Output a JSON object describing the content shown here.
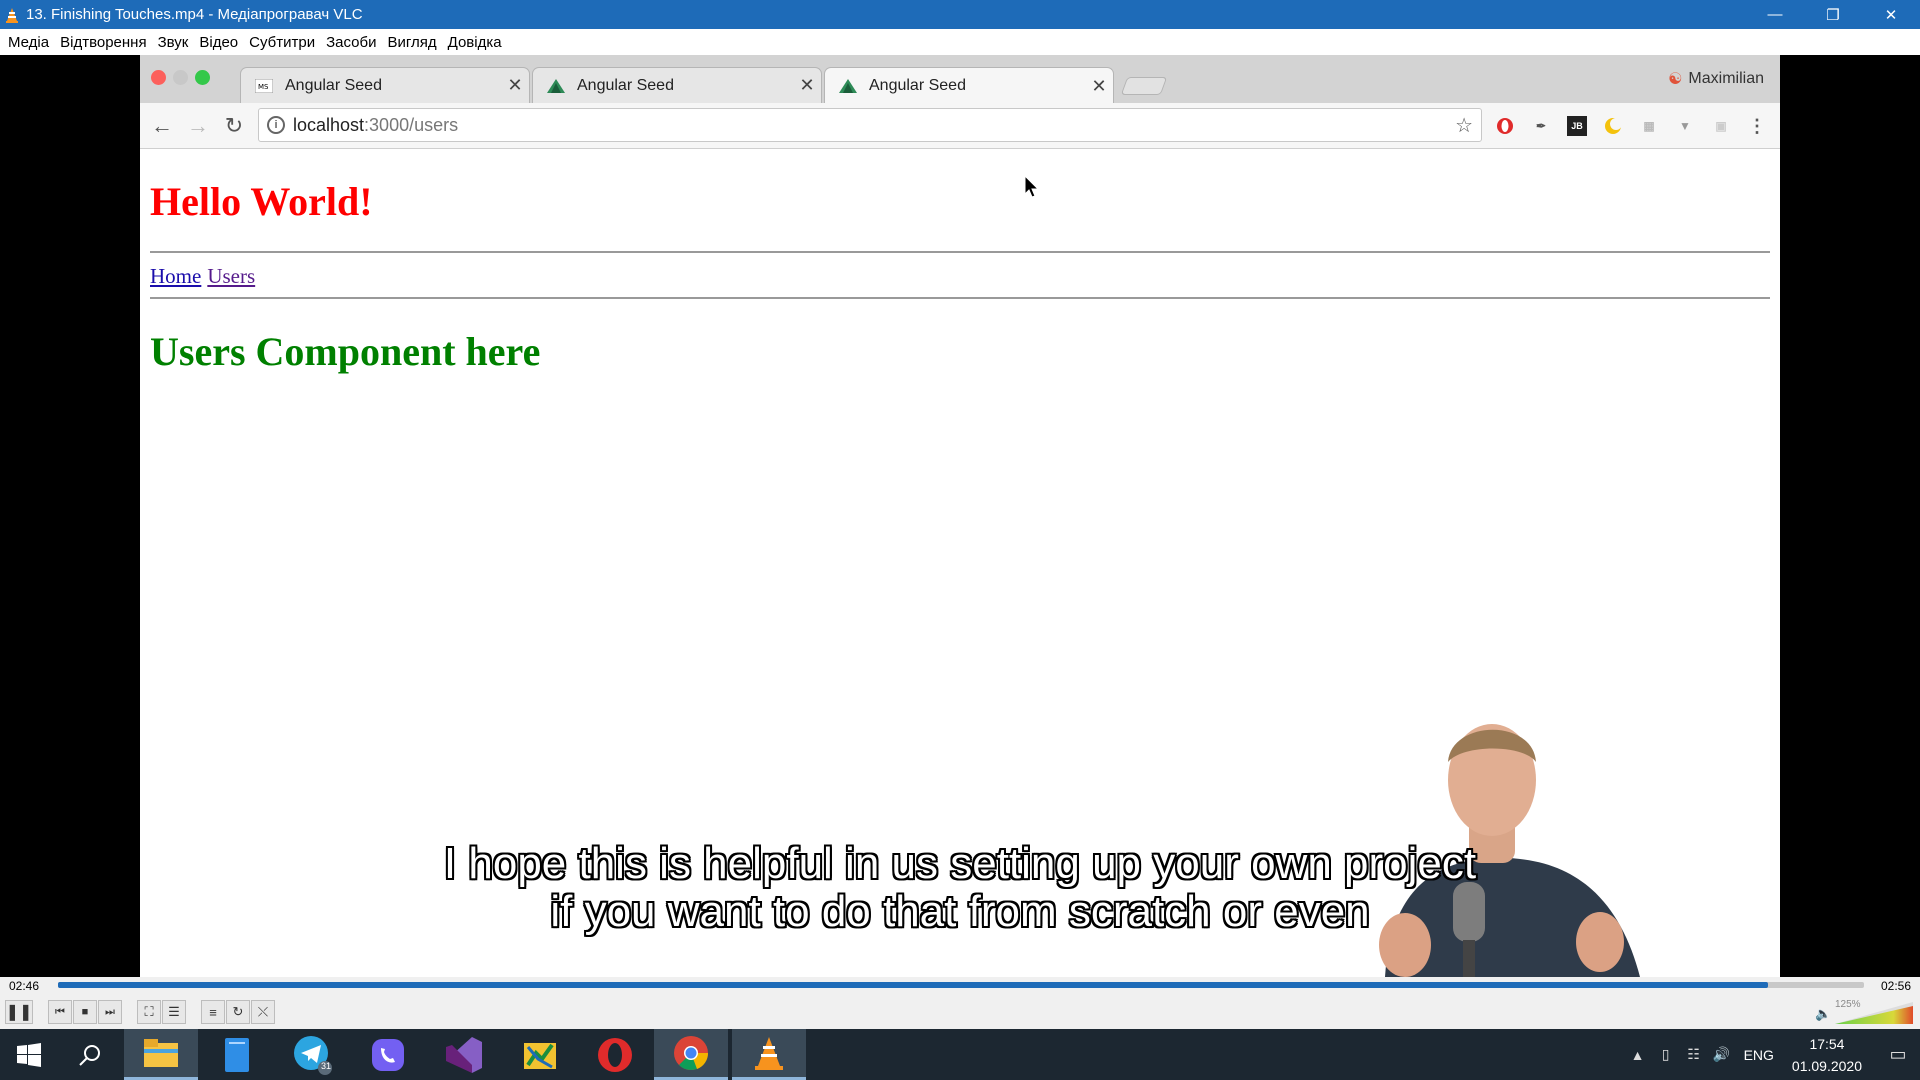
{
  "vlc": {
    "window_title": "13. Finishing Touches.mp4 - Медіапрогравач VLC",
    "menu": [
      "Медіа",
      "Відтворення",
      "Звук",
      "Відео",
      "Субтитри",
      "Засоби",
      "Вигляд",
      "Довідка"
    ],
    "time_elapsed": "02:46",
    "time_total": "02:56",
    "progress": 0.947,
    "volume_label": "125%",
    "subtitle_line1": "I hope this is helpful in us setting up your own project",
    "subtitle_line2": "if you want to do that from scratch or even"
  },
  "browser": {
    "tabs": [
      {
        "title": "Angular Seed",
        "active": false
      },
      {
        "title": "Angular Seed",
        "active": false
      },
      {
        "title": "Angular Seed",
        "active": true
      }
    ],
    "profile_name": "Maximilian",
    "url_host": "localhost",
    "url_path": ":3000/users"
  },
  "page": {
    "heading": "Hello World!",
    "nav_links": [
      "Home",
      "Users"
    ],
    "component_heading": "Users Component here"
  },
  "taskbar": {
    "apps": [
      "file-explorer",
      "store",
      "telegram",
      "viber",
      "visual-studio",
      "app",
      "opera",
      "chrome",
      "vlc"
    ],
    "telegram_badge": "31",
    "language": "ENG",
    "time": "17:54",
    "date": "01.09.2020"
  },
  "colors": {
    "vlc_blue": "#1e6bb8",
    "heading_red": "#ff0000",
    "heading_green": "#008000",
    "taskbar": "#1c2731"
  }
}
